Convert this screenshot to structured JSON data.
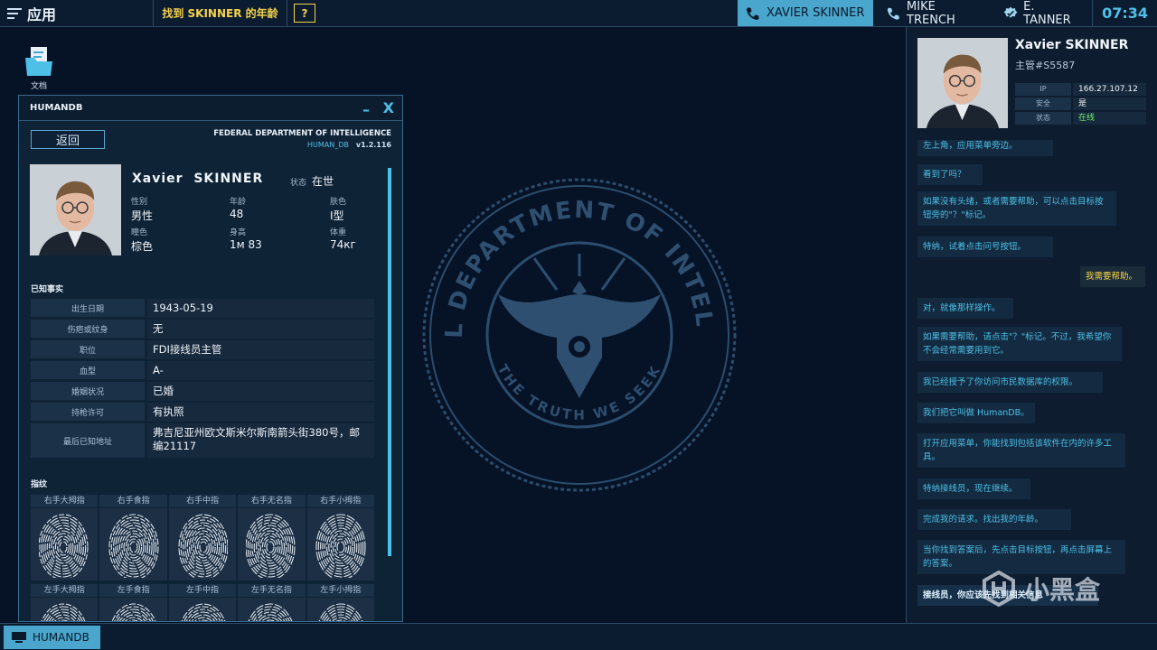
{
  "topbar": {
    "app_menu_label": "应用",
    "task_label": "找到 SKINNER 的年龄",
    "help_label": "?",
    "contacts": [
      {
        "name": "XAVIER SKINNER",
        "icon": "phone-icon",
        "active": true
      },
      {
        "name": "MIKE TRENCH",
        "icon": "phone-icon",
        "active": false
      },
      {
        "name": "E. TANNER",
        "icon": "verified-badge-icon",
        "active": false
      }
    ],
    "clock": "07:34"
  },
  "desktop": {
    "icon_label": "文档",
    "emblem": {
      "top_text": "FEDERAL DEPARTMENT OF INTELLIGENCE",
      "bottom_text": "THE TRUTH WE SEEK"
    }
  },
  "window": {
    "title": "HUMANDB",
    "minimize": "–",
    "close": "X",
    "back_label": "返回",
    "agency": "FEDERAL DEPARTMENT OF INTELLIGENCE",
    "db_name": "HUMAN_DB",
    "version": "v1.2.116",
    "profile": {
      "first_name": "Xavier",
      "last_name": "SKINNER",
      "status_label": "状态",
      "status_value": "在世",
      "attrs": [
        {
          "k": "性别",
          "v": "男性"
        },
        {
          "k": "年龄",
          "v": "48"
        },
        {
          "k": "肤色",
          "v": "I型"
        },
        {
          "k": "瞳色",
          "v": "棕色"
        },
        {
          "k": "身高",
          "v": "1м 83"
        },
        {
          "k": "体重",
          "v": "74кг"
        }
      ]
    },
    "facts_title": "已知事实",
    "facts": [
      {
        "k": "出生日期",
        "v": "1943-05-19"
      },
      {
        "k": "伤疤或纹身",
        "v": "无"
      },
      {
        "k": "职位",
        "v": "FDI接线员主管"
      },
      {
        "k": "血型",
        "v": "A-"
      },
      {
        "k": "婚姻状况",
        "v": "已婚"
      },
      {
        "k": "持枪许可",
        "v": "有执照"
      },
      {
        "k": "最后已知地址",
        "v": "弗吉尼亚州欧文斯米尔斯南箭头街380号，邮编21117"
      }
    ],
    "fingerprints_title": "指纹",
    "fingerprints_right": [
      "右手大拇指",
      "右手食指",
      "右手中指",
      "右手无名指",
      "右手小拇指"
    ],
    "fingerprints_left": [
      "左手大拇指",
      "左手食指",
      "左手中指",
      "左手无名指",
      "左手小拇指"
    ]
  },
  "chat": {
    "name": "Xavier SKINNER",
    "role": "主管#S5587",
    "info": [
      {
        "k": "IP",
        "v": "166.27.107.12"
      },
      {
        "k": "安全",
        "v": "是"
      },
      {
        "k": "状态",
        "v": "在线"
      }
    ],
    "messages": [
      {
        "text": "左上角，应用菜单旁边。",
        "from": "them"
      },
      {
        "text": "看到了吗？",
        "from": "them"
      },
      {
        "text": "如果没有头绪，或者需要帮助，可以点击目标按钮旁的\"？\"标记。",
        "from": "them"
      },
      {
        "text": "特纳，试着点击问号按钮。",
        "from": "them"
      },
      {
        "text": "我需要帮助。",
        "from": "me"
      },
      {
        "text": "对，就像那样操作。",
        "from": "them"
      },
      {
        "text": "如果需要帮助，请点击\"？\"标记。不过，我希望你不会经常需要用到它。",
        "from": "them"
      },
      {
        "text": "我已经授予了你访问市民数据库的权限。",
        "from": "them"
      },
      {
        "text": "我们把它叫做 HumanDB。",
        "from": "them"
      },
      {
        "text": "打开应用菜单，你能找到包括该软件在内的许多工具。",
        "from": "them"
      },
      {
        "text": "特纳接线员，现在继续。",
        "from": "them"
      },
      {
        "text": "完成我的请求。找出我的年龄。",
        "from": "them"
      },
      {
        "text": "当你找到答案后，先点击目标按钮，再点击屏幕上的答案。",
        "from": "them"
      },
      {
        "text": "接线员，你应该先找到相关信息",
        "from": "them",
        "highlight": true
      }
    ]
  },
  "taskbar": {
    "item_label": "HUMANDB"
  },
  "watermark": "小黑盒",
  "colors": {
    "accent": "#4ec0e8",
    "task_yellow": "#f6d34a",
    "online_green": "#6cf06c",
    "background": "#061226"
  }
}
